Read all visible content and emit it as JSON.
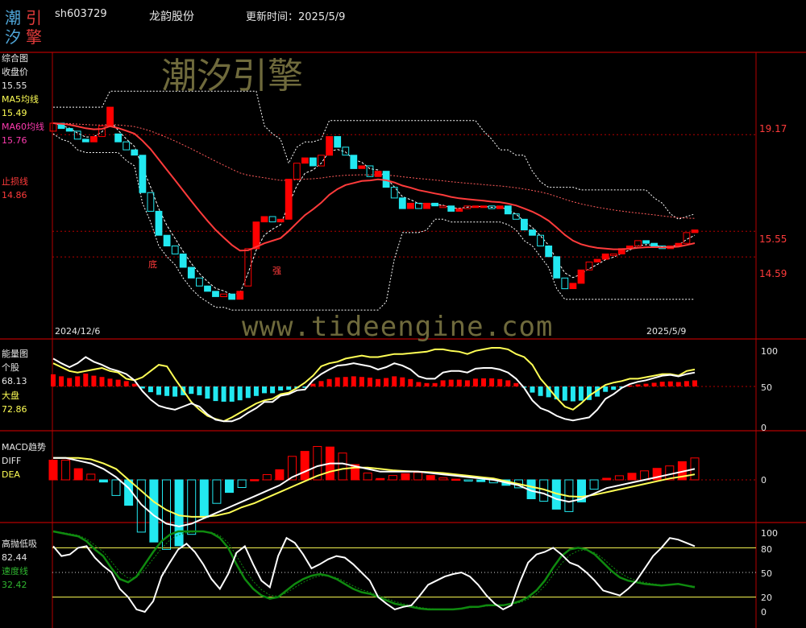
{
  "header": {
    "logo_chars": [
      "潮",
      "引",
      "汐",
      "擎"
    ],
    "code": "sh603729",
    "name": "龙韵股份",
    "update_label": "更新时间：2025/5/9"
  },
  "watermarks": {
    "cn": "潮汐引擎",
    "url": "www.tideengine.com"
  },
  "colors": {
    "up": "#ff0000",
    "down": "#22e8f0",
    "ma5": "#ffff55",
    "ma60": "#ff3b3b",
    "grid": "#b40000",
    "white": "#ffffff",
    "green": "#0f8a0f"
  },
  "panels": {
    "main": {
      "title": "综合图",
      "close_label": "收盘价",
      "close_value": "15.55",
      "ma5_label": "MA5均线",
      "ma5_value": "15.49",
      "ma60_label": "MA60均线",
      "ma60_value": "15.76",
      "stop_label": "止损线",
      "stop_value": "14.86",
      "date_start": "2024/12/6",
      "date_end": "2025/5/9",
      "price_ticks": [
        "19.17",
        "15.55",
        "14.59"
      ],
      "annotations": [
        {
          "text": "底",
          "index": 8
        },
        {
          "text": "强",
          "index": 18
        }
      ]
    },
    "energy": {
      "title": "能量图",
      "stock_label": "个股",
      "stock_value": "68.13",
      "market_label": "大盘",
      "market_value": "72.86",
      "ticks": [
        "100",
        "50",
        "0"
      ]
    },
    "macd": {
      "title": "MACD趋势",
      "diff_label": "DIFF",
      "dea_label": "DEA",
      "ticks": [
        "0"
      ]
    },
    "gaopao": {
      "title": "高抛低吸",
      "value": "82.44",
      "speed_label": "速度线",
      "speed_value": "32.42",
      "ticks": [
        "100",
        "80",
        "50",
        "20",
        "0"
      ]
    }
  },
  "chart_data": [
    {
      "type": "candlestick",
      "title": "综合图",
      "x_range": [
        "2024/12/6",
        "2025/5/9"
      ],
      "y_ticks": [
        19.17,
        15.55,
        14.59
      ],
      "closes": [
        19.6,
        19.4,
        19.3,
        19.0,
        18.9,
        19.1,
        19.5,
        20.2,
        18.9,
        18.6,
        18.4,
        17.0,
        16.3,
        15.4,
        15.0,
        14.7,
        14.2,
        13.8,
        13.5,
        13.3,
        13.1,
        13.2,
        13.0,
        13.3,
        14.9,
        15.9,
        16.1,
        15.9,
        16.0,
        17.5,
        18.1,
        18.3,
        18.0,
        18.4,
        19.1,
        18.7,
        18.4,
        17.9,
        18.0,
        17.6,
        17.8,
        17.2,
        16.8,
        16.4,
        16.6,
        16.4,
        16.6,
        16.5,
        16.5,
        16.3,
        16.4,
        16.5,
        16.5,
        16.5,
        16.4,
        16.5,
        16.2,
        16.0,
        15.6,
        15.4,
        15.0,
        14.6,
        13.8,
        13.4,
        13.6,
        14.1,
        14.4,
        14.5,
        14.7,
        14.7,
        14.9,
        15.0,
        15.2,
        15.1,
        15.0,
        14.9,
        15.0,
        15.1,
        15.5,
        15.6
      ],
      "opens": [
        19.3,
        19.6,
        19.4,
        19.3,
        19.0,
        18.9,
        19.1,
        19.5,
        19.2,
        18.9,
        18.6,
        18.4,
        17.0,
        16.3,
        15.4,
        15.0,
        14.7,
        14.2,
        13.8,
        13.5,
        13.3,
        13.1,
        13.2,
        13.0,
        13.5,
        14.9,
        15.9,
        16.1,
        15.9,
        16.0,
        17.5,
        18.1,
        18.3,
        18.0,
        18.4,
        19.1,
        18.7,
        18.4,
        17.9,
        18.0,
        17.6,
        17.8,
        17.2,
        16.8,
        16.4,
        16.6,
        16.4,
        16.6,
        16.5,
        16.5,
        16.3,
        16.4,
        16.5,
        16.5,
        16.5,
        16.4,
        16.5,
        16.2,
        16.0,
        15.6,
        15.4,
        15.0,
        14.6,
        13.8,
        13.4,
        13.6,
        14.1,
        14.4,
        14.5,
        14.7,
        14.7,
        14.9,
        15.0,
        15.2,
        15.1,
        15.0,
        14.9,
        15.0,
        15.1,
        15.5
      ],
      "ma60_line": true,
      "bands": "upper/mid/lower dashed"
    },
    {
      "type": "line+bar",
      "title": "能量图",
      "ylim": [
        0,
        100
      ],
      "series": [
        {
          "name": "个股",
          "values": [
            86,
            80,
            75,
            80,
            88,
            82,
            78,
            73,
            70,
            66,
            58,
            44,
            33,
            25,
            22,
            20,
            24,
            28,
            24,
            14,
            7,
            5,
            5,
            9,
            16,
            22,
            30,
            30,
            38,
            40,
            45,
            46,
            58,
            66,
            72,
            77,
            78,
            80,
            78,
            76,
            72,
            75,
            80,
            77,
            72,
            63,
            60,
            60,
            68,
            70,
            70,
            68,
            73,
            74,
            74,
            72,
            68,
            60,
            48,
            32,
            22,
            18,
            12,
            8,
            6,
            8,
            10,
            20,
            34,
            40,
            48,
            53,
            56,
            58,
            61,
            64,
            65,
            63,
            66,
            68
          ]
        },
        {
          "name": "大盘",
          "values": [
            80,
            75,
            70,
            68,
            70,
            72,
            74,
            70,
            68,
            60,
            58,
            62,
            70,
            78,
            76,
            60,
            45,
            30,
            20,
            12,
            8,
            5,
            10,
            16,
            22,
            28,
            32,
            34,
            40,
            42,
            48,
            55,
            64,
            76,
            80,
            82,
            86,
            88,
            90,
            88,
            88,
            90,
            92,
            92,
            93,
            94,
            95,
            98,
            98,
            96,
            95,
            92,
            96,
            98,
            100,
            100,
            98,
            92,
            88,
            78,
            60,
            48,
            35,
            24,
            20,
            28,
            38,
            45,
            52,
            55,
            57,
            60,
            60,
            62,
            64,
            66,
            66,
            64,
            70,
            72
          ]
        }
      ]
    },
    {
      "type": "line+bar",
      "title": "MACD趋势",
      "series": [
        {
          "name": "DIFF",
          "values": [
            0.8,
            0.8,
            0.7,
            0.6,
            0.4,
            0.1,
            -0.3,
            -0.9,
            -1.3,
            -1.6,
            -1.7,
            -1.6,
            -1.4,
            -1.2,
            -1.0,
            -0.8,
            -0.6,
            -0.4,
            -0.2,
            0.1,
            0.3,
            0.5,
            0.6,
            0.6,
            0.5,
            0.4,
            0.3,
            0.3,
            0.3,
            0.3,
            0.25,
            0.2,
            0.15,
            0.1,
            0.05,
            0.0,
            -0.1,
            -0.2,
            -0.4,
            -0.5,
            -0.7,
            -0.8,
            -0.7,
            -0.5,
            -0.3,
            -0.2,
            -0.1,
            0.0,
            0.1,
            0.2,
            0.3,
            0.4
          ]
        },
        {
          "name": "DEA",
          "values": [
            0.8,
            0.8,
            0.8,
            0.75,
            0.6,
            0.4,
            0.0,
            -0.4,
            -0.8,
            -1.1,
            -1.3,
            -1.35,
            -1.35,
            -1.3,
            -1.2,
            -1.0,
            -0.85,
            -0.65,
            -0.45,
            -0.25,
            -0.05,
            0.15,
            0.3,
            0.4,
            0.45,
            0.45,
            0.4,
            0.35,
            0.32,
            0.3,
            0.28,
            0.25,
            0.2,
            0.15,
            0.1,
            0.05,
            -0.05,
            -0.15,
            -0.25,
            -0.35,
            -0.5,
            -0.6,
            -0.62,
            -0.55,
            -0.45,
            -0.35,
            -0.25,
            -0.15,
            -0.05,
            0.05,
            0.12,
            0.2
          ]
        }
      ]
    },
    {
      "type": "line",
      "title": "高抛低吸",
      "ylim": [
        0,
        100
      ],
      "series": [
        {
          "name": "高抛低吸",
          "values": [
            82,
            70,
            72,
            80,
            82,
            68,
            58,
            50,
            30,
            20,
            5,
            2,
            15,
            45,
            62,
            78,
            85,
            75,
            60,
            42,
            30,
            48,
            74,
            82,
            60,
            40,
            32,
            70,
            92,
            86,
            72,
            55,
            60,
            66,
            70,
            68,
            60,
            50,
            40,
            20,
            12,
            5,
            8,
            10,
            22,
            35,
            40,
            45,
            48,
            50,
            45,
            35,
            22,
            12,
            5,
            10,
            38,
            62,
            72,
            75,
            80,
            72,
            62,
            58,
            50,
            40,
            28,
            25,
            22,
            30,
            40,
            55,
            70,
            80,
            92,
            90,
            86,
            82
          ]
        },
        {
          "name": "速度线",
          "values": [
            100,
            98,
            96,
            94,
            88,
            78,
            70,
            55,
            42,
            38,
            45,
            60,
            75,
            88,
            96,
            100,
            100,
            100,
            100,
            98,
            92,
            80,
            60,
            42,
            30,
            22,
            18,
            20,
            28,
            36,
            42,
            46,
            48,
            46,
            42,
            36,
            30,
            26,
            24,
            20,
            16,
            12,
            10,
            8,
            6,
            5,
            5,
            5,
            5,
            6,
            8,
            8,
            10,
            10,
            10,
            12,
            15,
            20,
            28,
            40,
            56,
            70,
            78,
            80,
            78,
            72,
            62,
            52,
            44,
            40,
            38,
            36,
            35,
            34,
            35,
            36,
            34,
            32
          ]
        }
      ]
    }
  ]
}
